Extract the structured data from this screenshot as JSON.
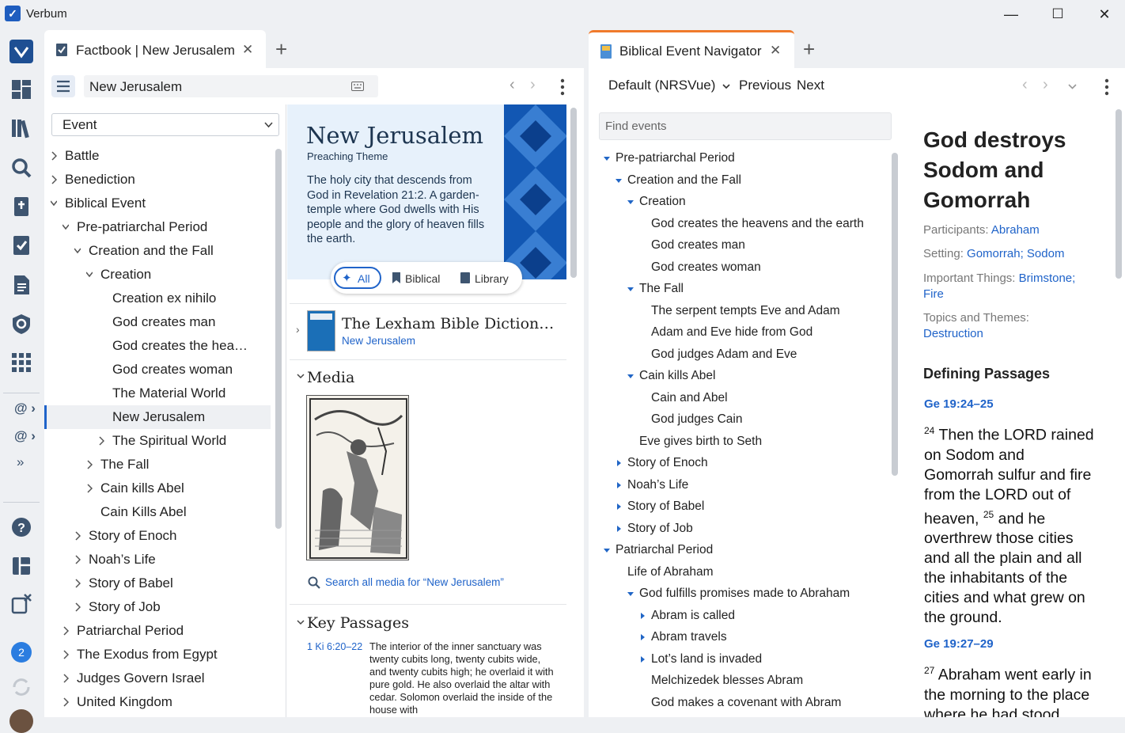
{
  "app": {
    "title": "Verbum"
  },
  "window": {
    "minimize": "—",
    "maximize": "☐",
    "close": "✕"
  },
  "rail": {
    "badge_count": "2"
  },
  "left_tab": {
    "title": "Factbook | New Jerusalem",
    "close": "✕",
    "add": "+"
  },
  "factbook": {
    "search_value": "New Jerusalem",
    "type_select": "Event",
    "tree": [
      {
        "label": "Battle",
        "indent": 0,
        "chev": "right"
      },
      {
        "label": "Benediction",
        "indent": 0,
        "chev": "right"
      },
      {
        "label": "Biblical Event",
        "indent": 0,
        "chev": "down"
      },
      {
        "label": "Pre-patriarchal Period",
        "indent": 1,
        "chev": "down"
      },
      {
        "label": "Creation and the Fall",
        "indent": 2,
        "chev": "down"
      },
      {
        "label": "Creation",
        "indent": 3,
        "chev": "down"
      },
      {
        "label": "Creation ex nihilo",
        "indent": 4,
        "chev": ""
      },
      {
        "label": "God creates man",
        "indent": 4,
        "chev": ""
      },
      {
        "label": "God creates the hea…",
        "indent": 4,
        "chev": ""
      },
      {
        "label": "God creates woman",
        "indent": 4,
        "chev": ""
      },
      {
        "label": "The Material World",
        "indent": 4,
        "chev": ""
      },
      {
        "label": "New Jerusalem",
        "indent": 4,
        "chev": "",
        "selected": true
      },
      {
        "label": "The Spiritual World",
        "indent": 4,
        "chev": "right"
      },
      {
        "label": "The Fall",
        "indent": 3,
        "chev": "right"
      },
      {
        "label": "Cain kills Abel",
        "indent": 3,
        "chev": "right"
      },
      {
        "label": "Cain Kills Abel",
        "indent": 3,
        "chev": ""
      },
      {
        "label": "Story of Enoch",
        "indent": 2,
        "chev": "right"
      },
      {
        "label": "Noah’s Life",
        "indent": 2,
        "chev": "right"
      },
      {
        "label": "Story of Babel",
        "indent": 2,
        "chev": "right"
      },
      {
        "label": "Story of Job",
        "indent": 2,
        "chev": "right"
      },
      {
        "label": "Patriarchal Period",
        "indent": 1,
        "chev": "right"
      },
      {
        "label": "The Exodus from Egypt",
        "indent": 1,
        "chev": "right"
      },
      {
        "label": "Judges Govern Israel",
        "indent": 1,
        "chev": "right"
      },
      {
        "label": "United Kingdom",
        "indent": 1,
        "chev": "right"
      }
    ],
    "header": {
      "title": "New Jerusalem",
      "subtitle": "Preaching Theme",
      "description": "The holy city that descends from God in Revelation 21:2. A garden-temple where God dwells with His people and the glory of heaven fills the earth."
    },
    "filters": {
      "all": "All",
      "biblical": "Biblical",
      "library": "Library"
    },
    "dictionary": {
      "title": "The Lexham Bible Diction…",
      "link": "New Jerusalem"
    },
    "media": {
      "heading": "Media",
      "search_link": "Search all media for “New Jerusalem”"
    },
    "key_passages": {
      "heading": "Key Passages",
      "ref": "1 Ki 6:20–22",
      "text": "The interior of the inner sanctuary was twenty cubits long, twenty cubits wide, and twenty cubits high; he overlaid it with pure gold. He also overlaid the altar with cedar. Solomon overlaid the inside of the house with"
    }
  },
  "right_tab": {
    "title": "Biblical Event Navigator",
    "close": "✕",
    "add": "+"
  },
  "navigator": {
    "version": "Default (NRSVue)",
    "previous": "Previous",
    "next": "Next",
    "find_placeholder": "Find events",
    "events": [
      {
        "label": "Pre-patriarchal Period",
        "indent": 0,
        "tri": "down"
      },
      {
        "label": "Creation and the Fall",
        "indent": 1,
        "tri": "down"
      },
      {
        "label": "Creation",
        "indent": 2,
        "tri": "down"
      },
      {
        "label": "God creates the heavens and the earth",
        "indent": 3,
        "tri": ""
      },
      {
        "label": "God creates man",
        "indent": 3,
        "tri": ""
      },
      {
        "label": "God creates woman",
        "indent": 3,
        "tri": ""
      },
      {
        "label": "The Fall",
        "indent": 2,
        "tri": "down"
      },
      {
        "label": "The serpent tempts Eve and Adam",
        "indent": 3,
        "tri": ""
      },
      {
        "label": "Adam and Eve hide from God",
        "indent": 3,
        "tri": ""
      },
      {
        "label": "God judges Adam and Eve",
        "indent": 3,
        "tri": ""
      },
      {
        "label": "Cain kills Abel",
        "indent": 2,
        "tri": "down"
      },
      {
        "label": "Cain and Abel",
        "indent": 3,
        "tri": ""
      },
      {
        "label": "God judges Cain",
        "indent": 3,
        "tri": ""
      },
      {
        "label": "Eve gives birth to Seth",
        "indent": 2,
        "tri": ""
      },
      {
        "label": "Story of Enoch",
        "indent": 1,
        "tri": "right"
      },
      {
        "label": "Noah’s Life",
        "indent": 1,
        "tri": "right"
      },
      {
        "label": "Story of Babel",
        "indent": 1,
        "tri": "right"
      },
      {
        "label": "Story of Job",
        "indent": 1,
        "tri": "right"
      },
      {
        "label": "Patriarchal Period",
        "indent": 0,
        "tri": "down"
      },
      {
        "label": "Life of Abraham",
        "indent": 1,
        "tri": ""
      },
      {
        "label": "God fulfills promises made to Abraham",
        "indent": 2,
        "tri": "down"
      },
      {
        "label": "Abram is called",
        "indent": 3,
        "tri": "right"
      },
      {
        "label": "Abram travels",
        "indent": 3,
        "tri": "right"
      },
      {
        "label": "Lot’s land is invaded",
        "indent": 3,
        "tri": "right"
      },
      {
        "label": "Melchizedek blesses Abram",
        "indent": 3,
        "tri": ""
      },
      {
        "label": "God makes a covenant with Abram",
        "indent": 3,
        "tri": ""
      }
    ],
    "detail": {
      "title": "God destroys Sodom and Gomorrah",
      "participants_label": "Participants:",
      "participants": "Abraham",
      "setting_label": "Setting:",
      "setting_1": "Gomorrah",
      "setting_sep": ";",
      "setting_2": "Sodom",
      "things_label": "Important Things:",
      "things_1": "Brimstone",
      "things_sep": ";",
      "things_2": "Fire",
      "topics_label": "Topics and Themes:",
      "topics": "Destruction",
      "passages_heading": "Defining Passages",
      "ref1": "Ge 19:24–25",
      "v24_num": "24",
      "v24_text": "Then the LORD rained on Sodom and Gomorrah sulfur and fire from the LORD out of heaven,",
      "v25_num": "25",
      "v25_text": "and he overthrew those cities and all the plain and all the inhabitants of the cities and what grew on the ground.",
      "ref2": "Ge 19:27–29",
      "v27_num": "27",
      "v27_text": "Abraham went early in the morning to the place where he had stood"
    }
  }
}
